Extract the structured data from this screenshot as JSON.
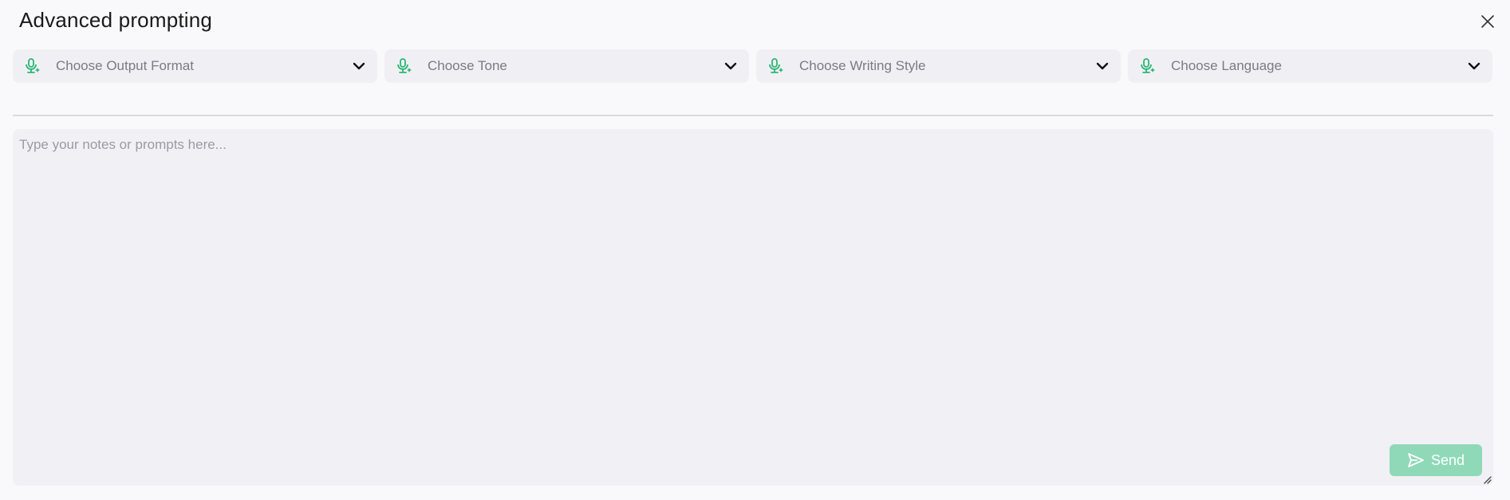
{
  "dialog": {
    "title": "Advanced prompting",
    "close_icon": "close-icon"
  },
  "selects": [
    {
      "placeholder": "Choose Output Format",
      "icon": "mic-sparkle-icon"
    },
    {
      "placeholder": "Choose Tone",
      "icon": "mic-sparkle-icon"
    },
    {
      "placeholder": "Choose Writing Style",
      "icon": "mic-sparkle-icon"
    },
    {
      "placeholder": "Choose Language",
      "icon": "mic-sparkle-icon"
    }
  ],
  "editor": {
    "placeholder": "Type your notes or prompts here...",
    "value": ""
  },
  "send": {
    "label": "Send",
    "icon": "send-icon"
  },
  "colors": {
    "accent": "#2bb673",
    "send_bg": "#8fd9b8"
  }
}
